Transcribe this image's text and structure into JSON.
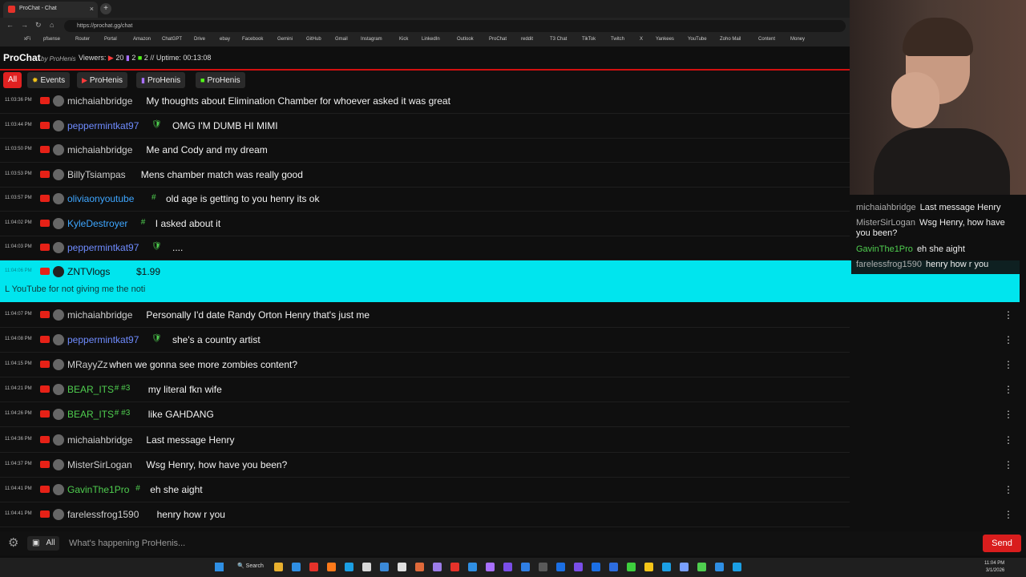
{
  "browser": {
    "tab_title": "ProChat - Chat",
    "tab_close": "×",
    "new_tab": "+",
    "url": "https://prochat.gg/chat",
    "bookmarks": [
      "xFi",
      "pfsense",
      "Router",
      "Portal",
      "Amazon",
      "ChatGPT",
      "Drive",
      "ebay",
      "Facebook",
      "Gemini",
      "GitHub",
      "Gmail",
      "Instagram",
      "Kick",
      "LinkedIn",
      "Outlook",
      "ProChat",
      "reddit",
      "T3 Chat",
      "TikTok",
      "Twitch",
      "X",
      "Yankees",
      "YouTube",
      "Zoho Mail",
      "Content",
      "Money"
    ]
  },
  "header": {
    "logo": "ProChat",
    "by": "by ProHenis",
    "viewers_label": "Viewers:",
    "youtube_count": "20",
    "twitch_count": "2",
    "kick_count": "2",
    "uptime_label": "Uptime: 00:13:08"
  },
  "filters": [
    {
      "label": "All"
    },
    {
      "label": "Events"
    },
    {
      "label": "ProHenis"
    },
    {
      "label": "ProHenis"
    },
    {
      "label": "ProHenis"
    }
  ],
  "messages": [
    {
      "time": "11:03:36 PM",
      "user": "michaiahbridge",
      "color": "#cfcfcf",
      "text": "My thoughts about Elimination Chamber for whoever asked it was great",
      "badge": ""
    },
    {
      "time": "11:03:44 PM",
      "user": "peppermintkat97",
      "color": "#6f8cff",
      "text": "OMG I'M DUMB HI MIMI",
      "badge": "🛡"
    },
    {
      "time": "11:03:50 PM",
      "user": "michaiahbridge",
      "color": "#cfcfcf",
      "text": "Me and Cody and my dream",
      "badge": ""
    },
    {
      "time": "11:03:53 PM",
      "user": "BillyTsiampas",
      "color": "#cfcfcf",
      "text": "Mens chamber match was really good",
      "badge": ""
    },
    {
      "time": "11:03:57 PM",
      "user": "oliviaonyoutube",
      "color": "#3ea6ff",
      "text": "old age is getting to you henry its ok",
      "badge": "#"
    },
    {
      "time": "11:04:02 PM",
      "user": "KyleDestroyer",
      "color": "#3ea6ff",
      "text": "I asked about it",
      "badge": "#"
    },
    {
      "time": "11:04:03 PM",
      "user": "peppermintkat97",
      "color": "#6f8cff",
      "text": "....",
      "badge": "🛡"
    }
  ],
  "superchat": {
    "time": "11:04:06 PM",
    "user": "ZNTVlogs",
    "amount": "$1.99",
    "text": "L YouTube for not giving me the noti"
  },
  "messages_after": [
    {
      "time": "11:04:07 PM",
      "user": "michaiahbridge",
      "color": "#cfcfcf",
      "text": "Personally I'd date Randy Orton Henry that's just me",
      "badge": ""
    },
    {
      "time": "11:04:08 PM",
      "user": "peppermintkat97",
      "color": "#6f8cff",
      "text": "she's a country artist",
      "badge": "🛡"
    },
    {
      "time": "11:04:15 PM",
      "user": "MRayyZz",
      "color": "#cfcfcf",
      "text": "when we gonna see more zombies content?",
      "badge": ""
    },
    {
      "time": "11:04:21 PM",
      "user": "BEAR_ITS",
      "color": "#4fce4f",
      "text": "my literal fkn wife",
      "badge": "# #3"
    },
    {
      "time": "11:04:26 PM",
      "user": "BEAR_ITS",
      "color": "#4fce4f",
      "text": "like GAHDANG",
      "badge": "# #3"
    },
    {
      "time": "11:04:36 PM",
      "user": "michaiahbridge",
      "color": "#cfcfcf",
      "text": "Last message Henry",
      "badge": ""
    },
    {
      "time": "11:04:37 PM",
      "user": "MisterSirLogan",
      "color": "#cfcfcf",
      "text": "Wsg Henry, how have you been?",
      "badge": ""
    },
    {
      "time": "11:04:41 PM",
      "user": "GavinThe1Pro",
      "color": "#4fce4f",
      "text": "eh she aight",
      "badge": "#"
    },
    {
      "time": "11:04:41 PM",
      "user": "farelessfrog1590",
      "color": "#cfcfcf",
      "text": "henry how r you",
      "badge": ""
    }
  ],
  "overlay": [
    {
      "user": "michaiahbridge",
      "text": "Last message Henry"
    },
    {
      "user": "MisterSirLogan",
      "text": "Wsg Henry, how have you been?"
    },
    {
      "user": "GavinThe1Pro",
      "text": "eh she aight"
    },
    {
      "user": "farelessfrog1590",
      "text": "henry how r you"
    }
  ],
  "composer": {
    "platform_label": "All",
    "placeholder": "What's happening ProHenis...",
    "send_label": "Send"
  },
  "taskbar": {
    "search_label": "Search",
    "time": "11:04 PM",
    "date": "3/1/2026"
  },
  "colors": {
    "accent_red": "#d91d1d",
    "superchat_bg": "#00e5ee"
  }
}
